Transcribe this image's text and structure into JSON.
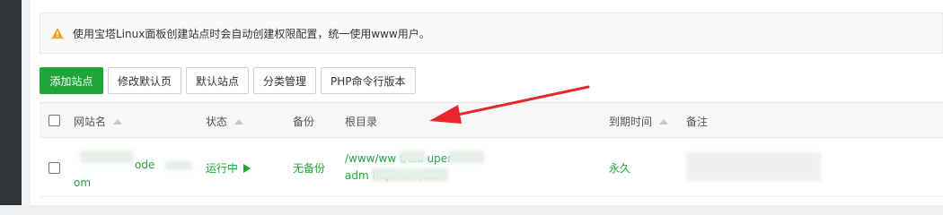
{
  "notice": {
    "text": "使用宝塔Linux面板创建站点时会自动创建权限配置，统一使用www用户。"
  },
  "toolbar": {
    "add_site": "添加站点",
    "edit_default_page": "修改默认页",
    "default_site": "默认站点",
    "category_manage": "分类管理",
    "php_cli_version": "PHP命令行版本"
  },
  "table": {
    "headers": {
      "name": "网站名",
      "status": "状态",
      "backup": "备份",
      "root": "根目录",
      "expire": "到期时间",
      "remark": "备注"
    },
    "rows": [
      {
        "name_line1": "ode",
        "name_line2": "om",
        "status": "运行中",
        "backup": "无备份",
        "root_line1": "/www/ww t/ala uper-",
        "root_line2": "adm hop.com/dist",
        "expire": "永久",
        "remark": ""
      }
    ]
  },
  "colors": {
    "accent": "#20a53a",
    "annotation_arrow": "#e8262b",
    "warning": "#f0a020"
  }
}
